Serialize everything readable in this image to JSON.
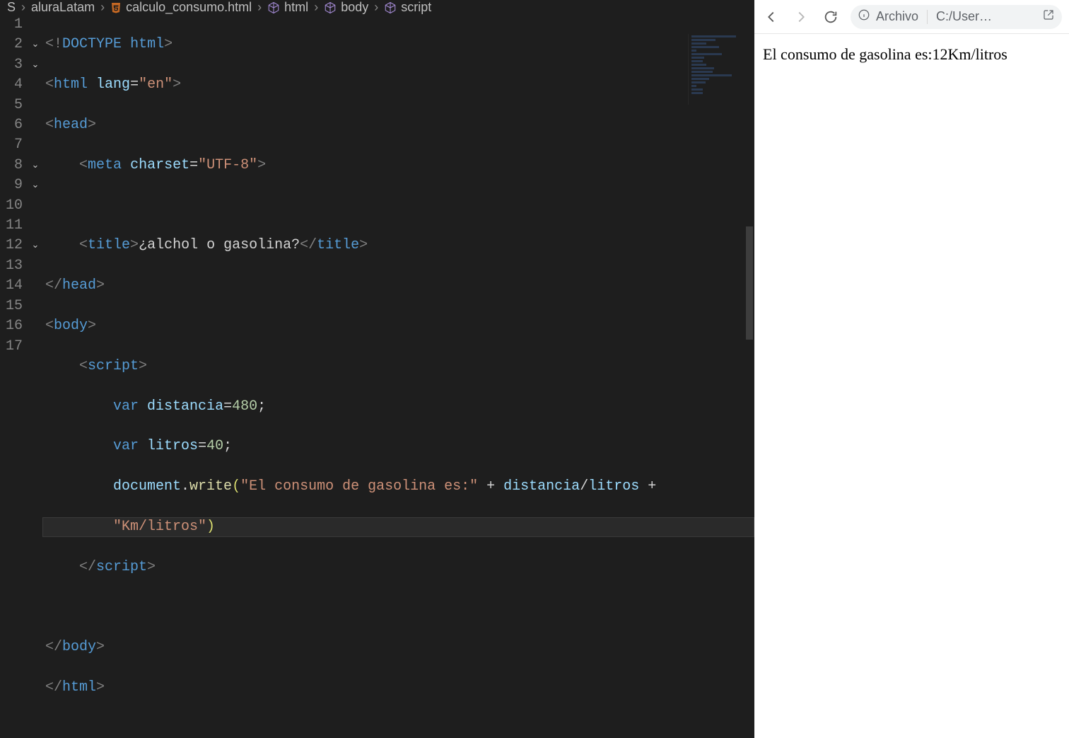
{
  "breadcrumbs": {
    "crumb0": "S",
    "crumb1": "aluraLatam",
    "crumb2": "calculo_consumo.html",
    "crumb3": "html",
    "crumb4": "body",
    "crumb5": "script"
  },
  "gutter": {
    "l1": "1",
    "l2": "2",
    "l3": "3",
    "l4": "4",
    "l5": "5",
    "l6": "6",
    "l7": "7",
    "l8": "8",
    "l9": "9",
    "l10": "10",
    "l11": "11",
    "l12": "12",
    "l13": "13",
    "l14": "14",
    "l15": "15",
    "l16": "16",
    "l17": "17"
  },
  "fold": {
    "down": "⌄"
  },
  "code": {
    "punc_lt": "<",
    "punc_gt": ">",
    "punc_ltsl": "</",
    "punc_sl_gt": "/>",
    "bang": "!",
    "doctype": "DOCTYPE",
    "html_kw": "html",
    "tag_html": "html",
    "tag_head": "head",
    "tag_meta": "meta",
    "tag_title": "title",
    "tag_body": "body",
    "tag_script": "script",
    "attr_lang": "lang",
    "val_lang": "\"en\"",
    "attr_charset": "charset",
    "val_charset": "\"UTF-8\"",
    "title_text": "¿alchol o gasolina?",
    "kw_var": "var",
    "var_dist": "distancia",
    "num_480": "480",
    "var_litros": "litros",
    "num_40": "40",
    "obj_doc": "document",
    "fn_write": "write",
    "str1": "\"El consumo de gasolina es:\"",
    "op_plus": " + ",
    "div_expr_a": "distancia",
    "div_slash": "/",
    "div_expr_b": "litros",
    "str2": "\"Km/litros\"",
    "semi": ";",
    "eq": "=",
    "dot": ".",
    "paren_o": "(",
    "paren_c": ")"
  },
  "browser": {
    "addr_label": "Archivo",
    "addr_path": "C:/User…",
    "page_text": "El consumo de gasolina es:12Km/litros"
  }
}
